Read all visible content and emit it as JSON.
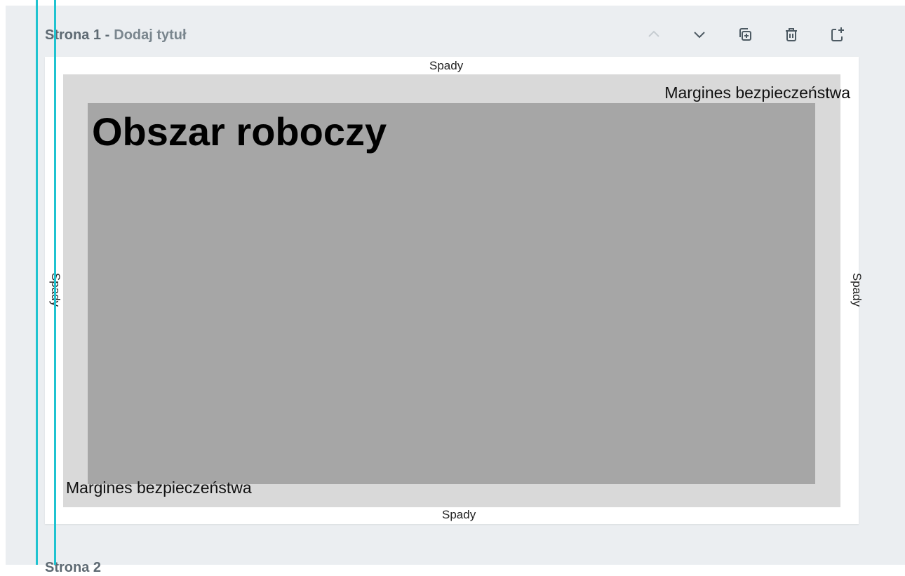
{
  "page_header": {
    "page_label": "Strona 1 -",
    "title_placeholder": "Dodaj tytuł"
  },
  "toolbar": {
    "move_up_icon": "chevron-up-icon",
    "move_down_icon": "chevron-down-icon",
    "duplicate_icon": "duplicate-icon",
    "delete_icon": "trash-icon",
    "add_page_icon": "add-page-icon"
  },
  "canvas": {
    "bleed_top": "Spady",
    "bleed_bottom": "Spady",
    "bleed_left": "Spady",
    "bleed_right": "Spady",
    "safe_margin_top": "Margines bezpieczeństwa",
    "safe_margin_bottom": "Margines bezpieczeństwa",
    "work_area_title": "Obszar roboczy"
  },
  "next_page": {
    "label": "Strona 2"
  },
  "colors": {
    "background": "#ebeef1",
    "guide": "#1fc3d0",
    "safe_zone": "#d9d9d9",
    "work_area": "#a6a6a6"
  }
}
